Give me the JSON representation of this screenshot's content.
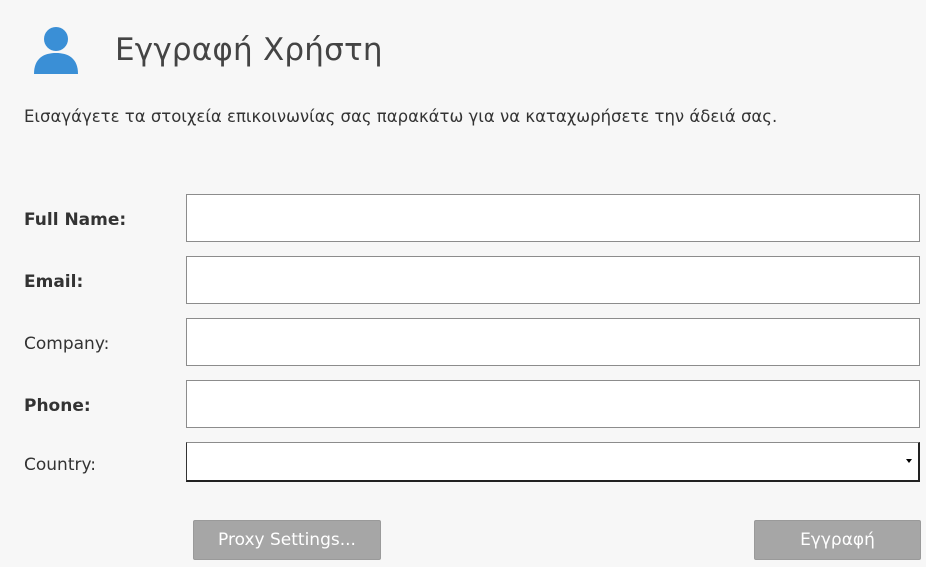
{
  "header": {
    "icon": "user-icon",
    "title": "Εγγραφή Χρήστη"
  },
  "intro": {
    "text": "Εισαγάγετε τα στοιχεία επικοινωνίας σας παρακάτω για να καταχωρήσετε την άδειά σας."
  },
  "form": {
    "full_name": {
      "label": "Full Name:",
      "value": "",
      "required": true
    },
    "email": {
      "label": "Email:",
      "value": "",
      "required": true
    },
    "company": {
      "label": "Company:",
      "value": "",
      "required": false
    },
    "phone": {
      "label": "Phone:",
      "value": "",
      "required": true
    },
    "country": {
      "label": "Country:",
      "selected": "",
      "required": false
    }
  },
  "buttons": {
    "proxy_label": "Proxy Settings...",
    "register_label": "Εγγραφή"
  },
  "colors": {
    "icon_blue": "#3a8fd6",
    "button_gray": "#a6a6a6",
    "panel_bg": "#f7f7f7"
  }
}
